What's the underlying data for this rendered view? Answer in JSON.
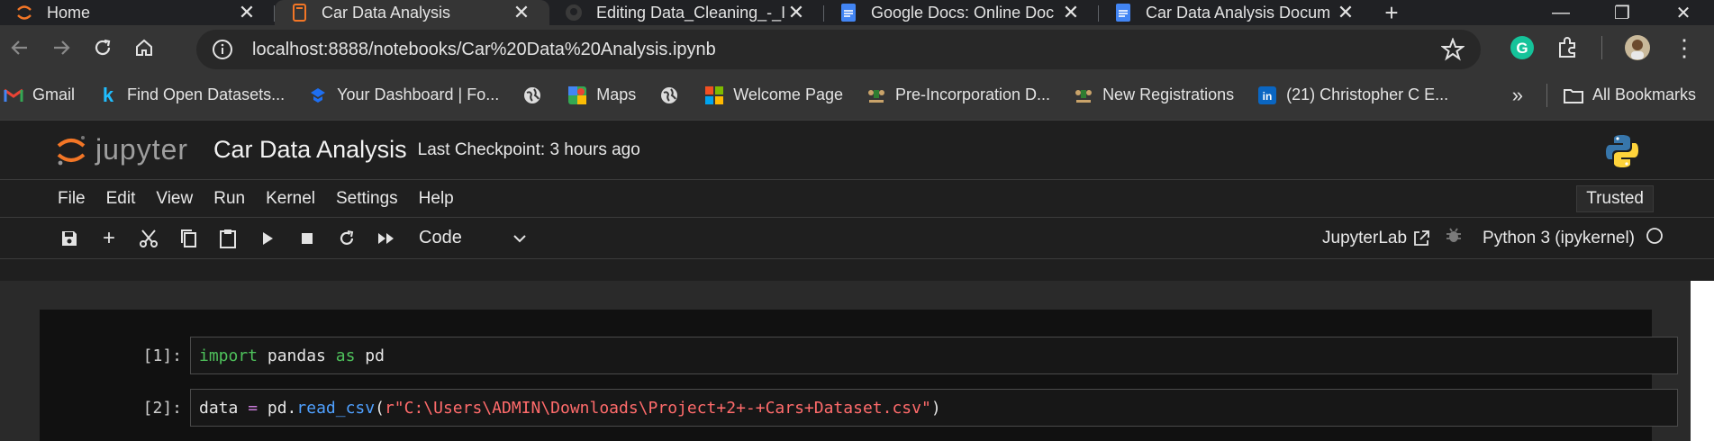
{
  "browser": {
    "tabs": [
      {
        "label": "Home",
        "icon": "jupyter-icon",
        "active": false
      },
      {
        "label": "Car Data Analysis",
        "icon": "notebook-icon",
        "active": true
      },
      {
        "label": "Editing Data_Cleaning_-_I",
        "icon": "github-icon",
        "active": false
      },
      {
        "label": "Google Docs: Online Doc",
        "icon": "google-docs-icon",
        "active": false
      },
      {
        "label": "Car Data Analysis Docum",
        "icon": "google-docs-icon",
        "active": false
      }
    ],
    "url": "localhost:8888/notebooks/Car%20Data%20Analysis.ipynb",
    "bookmarks": [
      {
        "label": "Gmail",
        "icon": "gmail-icon"
      },
      {
        "label": "Find Open Datasets...",
        "icon": "kaggle-icon"
      },
      {
        "label": "Your Dashboard | Fo...",
        "icon": "dashboard-icon"
      },
      {
        "label": "",
        "icon": "globe-icon"
      },
      {
        "label": "Maps",
        "icon": "maps-icon"
      },
      {
        "label": "",
        "icon": "globe-icon"
      },
      {
        "label": "Welcome Page",
        "icon": "microsoft-icon"
      },
      {
        "label": "Pre-Incorporation D...",
        "icon": "coat-of-arms-icon"
      },
      {
        "label": "New Registrations",
        "icon": "coat-of-arms-icon"
      },
      {
        "label": "(21) Christopher C E...",
        "icon": "linkedin-icon"
      }
    ],
    "all_bookmarks_label": "All Bookmarks"
  },
  "jupyter": {
    "wordmark": "jupyter",
    "title": "Car Data Analysis",
    "checkpoint": "Last Checkpoint: 3 hours ago",
    "menu": [
      "File",
      "Edit",
      "View",
      "Run",
      "Kernel",
      "Settings",
      "Help"
    ],
    "trusted": "Trusted",
    "cell_type": "Code",
    "jupyterlab_label": "JupyterLab",
    "kernel_label": "Python 3 (ipykernel)"
  },
  "cells": [
    {
      "prompt": "[1]:",
      "code_parts": {
        "a": "import",
        "b": " pandas ",
        "c": "as",
        "d": " pd"
      }
    },
    {
      "prompt": "[2]:",
      "code_parts": {
        "a": "data ",
        "b": "=",
        "c": " pd",
        "d": ".",
        "e": "read_csv",
        "f": "(",
        "g": "r\"C:\\Users\\ADMIN\\Downloads\\Project+2+-+Cars+Dataset.csv\"",
        "h": ")"
      }
    }
  ],
  "colors": {
    "accent_orange": "#f37626",
    "keyword_green": "#4ec15b",
    "string_red": "#ff6b6b",
    "function_blue": "#4fa0ff"
  }
}
